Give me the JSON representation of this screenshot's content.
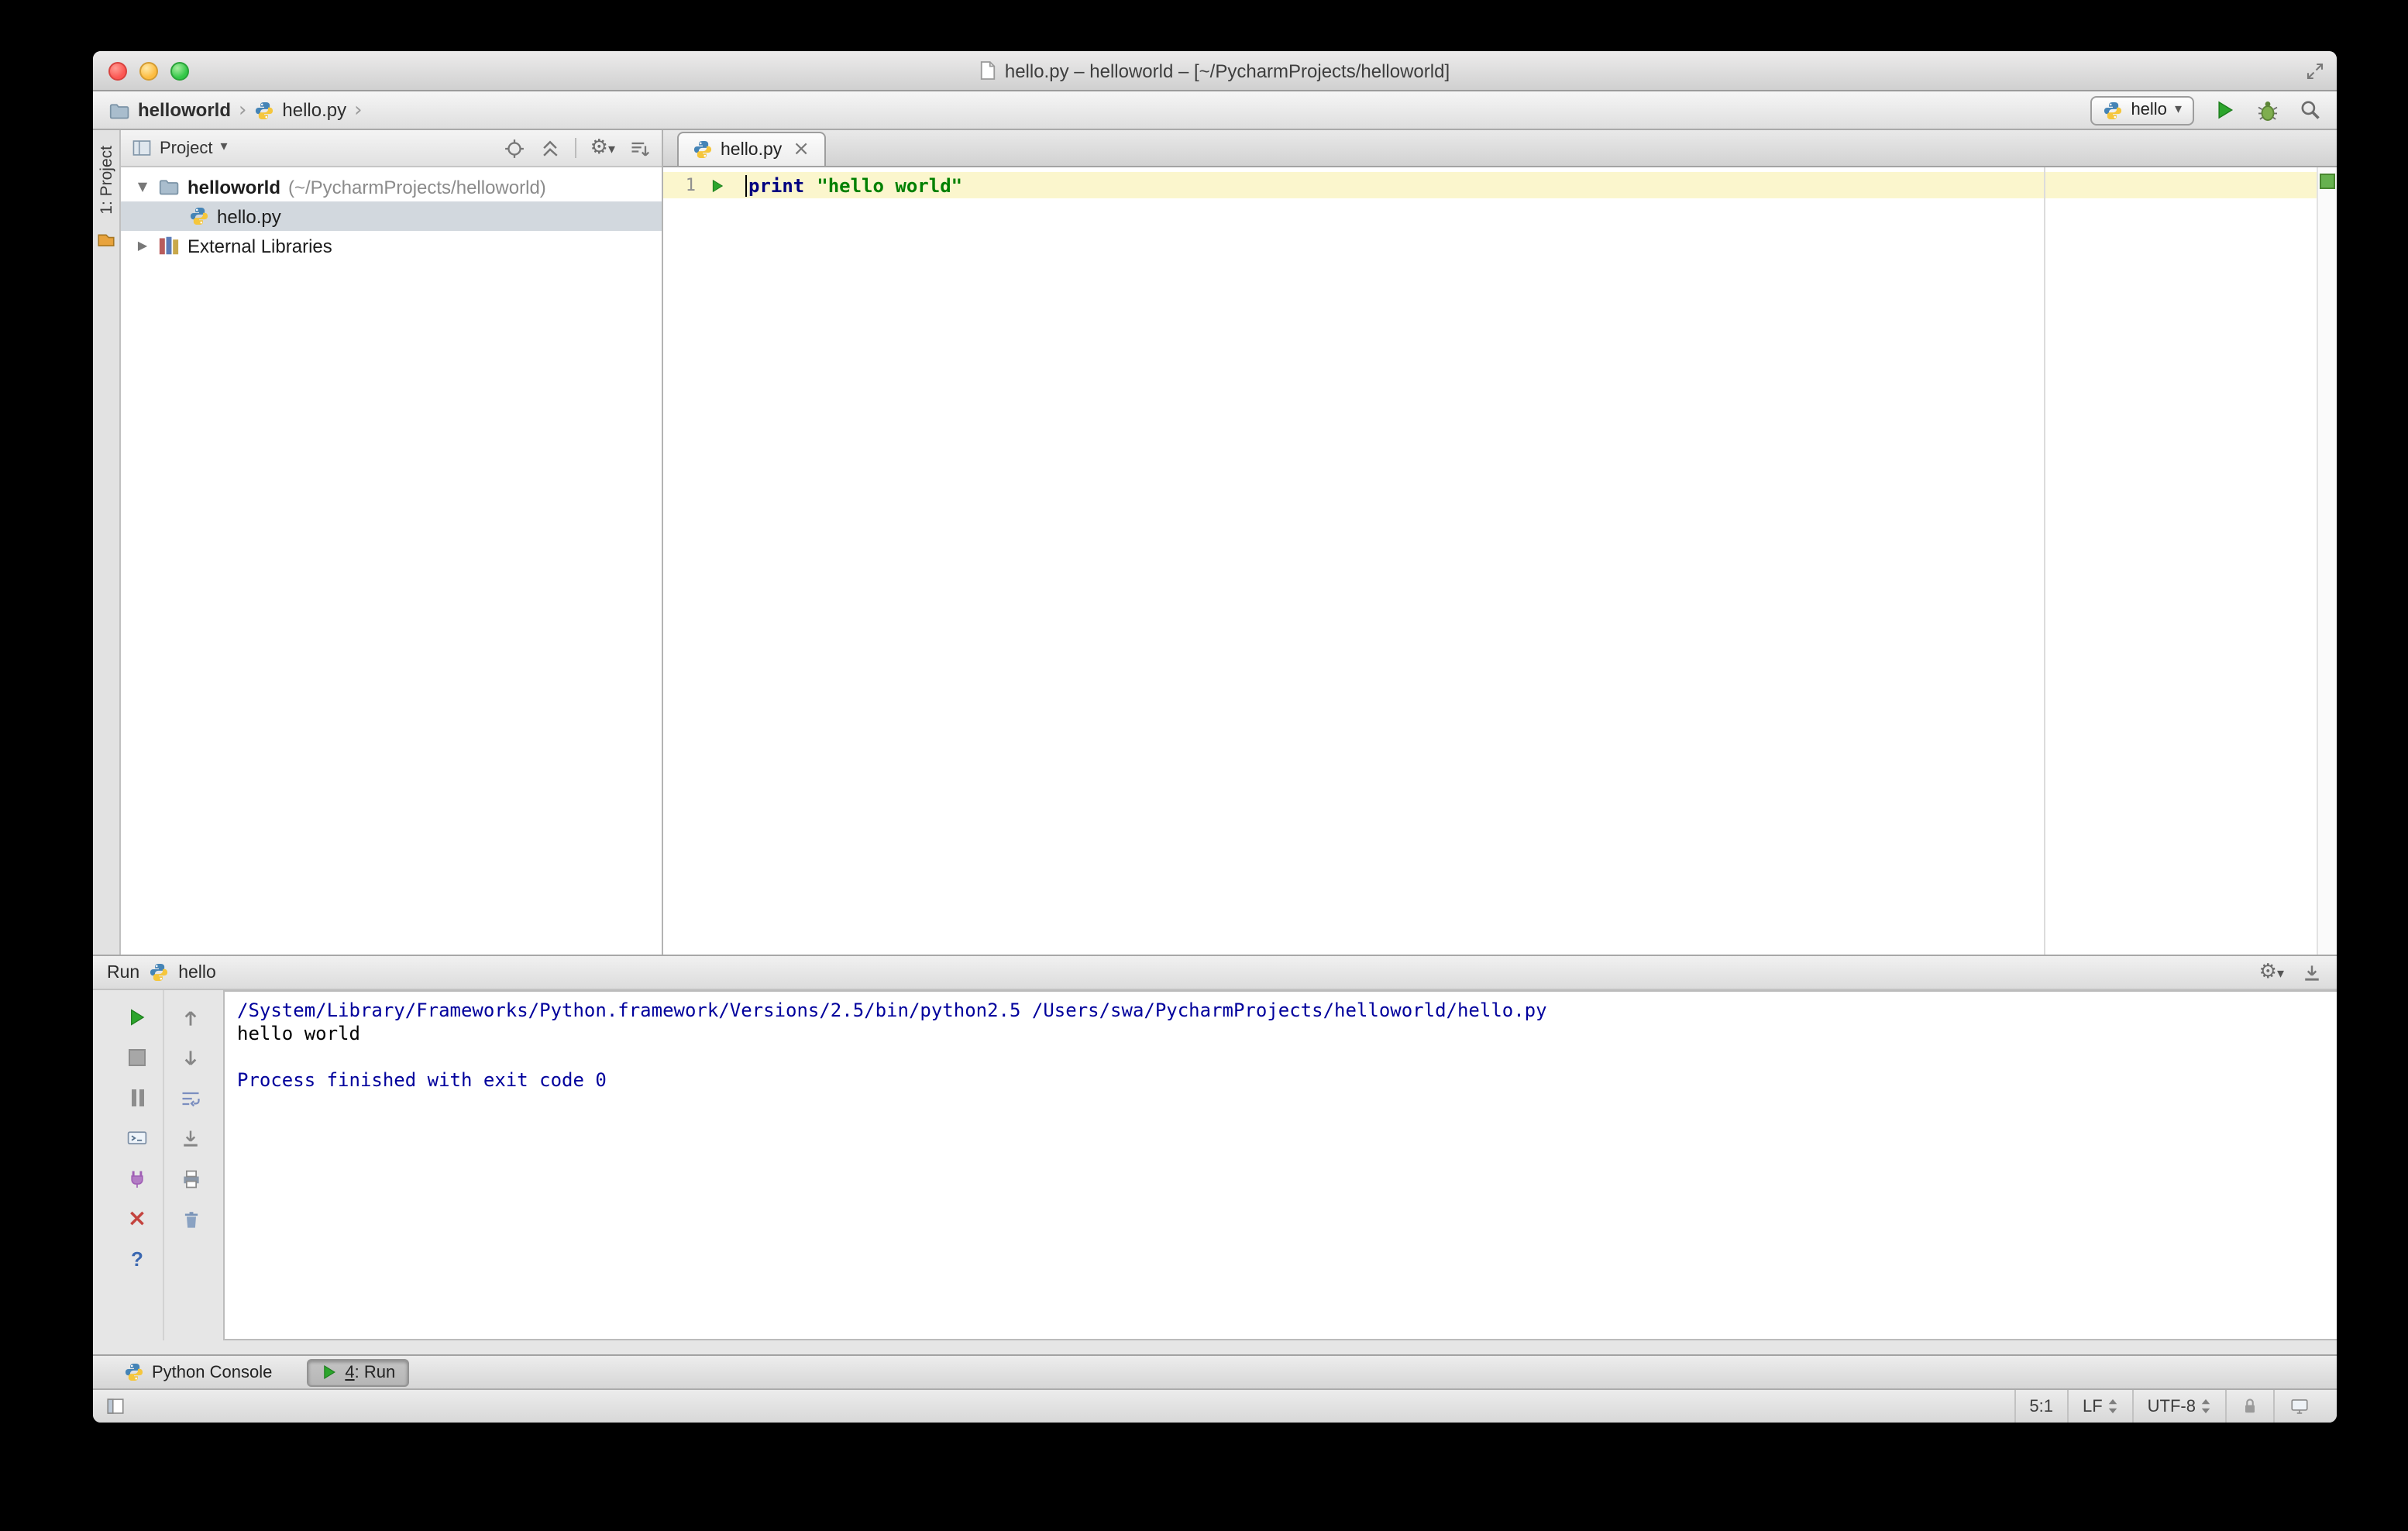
{
  "window": {
    "title": "hello.py – helloworld – [~/PycharmProjects/helloworld]"
  },
  "navbar": {
    "breadcrumbs": [
      "helloworld",
      "hello.py"
    ],
    "run_config_label": "hello"
  },
  "tool_stripe": {
    "label": "1: Project"
  },
  "project_panel": {
    "header_label": "Project",
    "tree": {
      "root_name": "helloworld",
      "root_path": "(~/PycharmProjects/helloworld)",
      "file": "hello.py",
      "external_libraries": "External Libraries"
    }
  },
  "editor": {
    "tab_label": "hello.py",
    "line_number": "1",
    "code_keyword": "print",
    "code_string": "\"hello world\""
  },
  "run_panel": {
    "title": "Run",
    "process_label": "hello",
    "console_lines": [
      {
        "text": "/System/Library/Frameworks/Python.framework/Versions/2.5/bin/python2.5 /Users/swa/PycharmProjects/helloworld/hello.py",
        "style": "system"
      },
      {
        "text": "hello world",
        "style": "stdout"
      },
      {
        "text": "",
        "style": "stdout"
      },
      {
        "text": "Process finished with exit code 0",
        "style": "system"
      }
    ]
  },
  "bottom_bar": {
    "python_console_label": "Python Console",
    "run_tab_number": "4",
    "run_tab_rest": ": Run"
  },
  "status_bar": {
    "caret_position": "5:1",
    "line_separator": "LF",
    "encoding": "UTF-8"
  },
  "icons": {
    "dropdown_arrow": "▾",
    "breadcrumb_chevron": "›",
    "tree_expanded": "▼",
    "tree_collapsed": "▶",
    "tab_close": "×",
    "gear": "⚙",
    "close_x": "×",
    "help": "?"
  },
  "colors": {
    "keyword": "#000080",
    "string": "#008000",
    "console_system": "#00009c",
    "caret_row": "#fbf6cd",
    "tree_selection": "#d2d8de",
    "run_green": "#2ca52c"
  }
}
